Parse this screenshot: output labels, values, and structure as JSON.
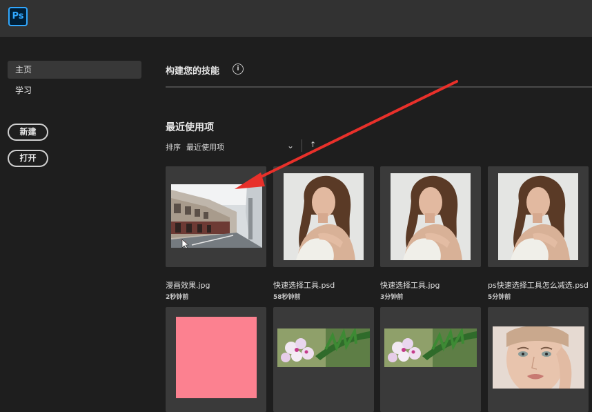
{
  "app": {
    "logo": "Ps"
  },
  "sidebar": {
    "items": [
      {
        "label": "主页",
        "active": true
      },
      {
        "label": "学习",
        "active": false
      }
    ],
    "new_label": "新建",
    "open_label": "打开"
  },
  "main": {
    "section_title": "构建您的技能",
    "info_icon": "i",
    "recent_title": "最近使用项",
    "sort_label": "排序",
    "sort_value": "最近使用项",
    "chevron": "⌄",
    "sort_direction": "↑"
  },
  "files": [
    {
      "name": "漫画效果.jpg",
      "time": "2秒钟前"
    },
    {
      "name": "快速选择工具.psd",
      "time": "58秒钟前"
    },
    {
      "name": "快速选择工具.jpg",
      "time": "3分钟前"
    },
    {
      "name": "ps快速选择工具怎么减选.psd",
      "time": "5分钟前"
    }
  ],
  "colors": {
    "accent": "#31a8ff",
    "arrow": "#e8302a",
    "card": "#3a3a3a",
    "pink": "#fc8190"
  }
}
